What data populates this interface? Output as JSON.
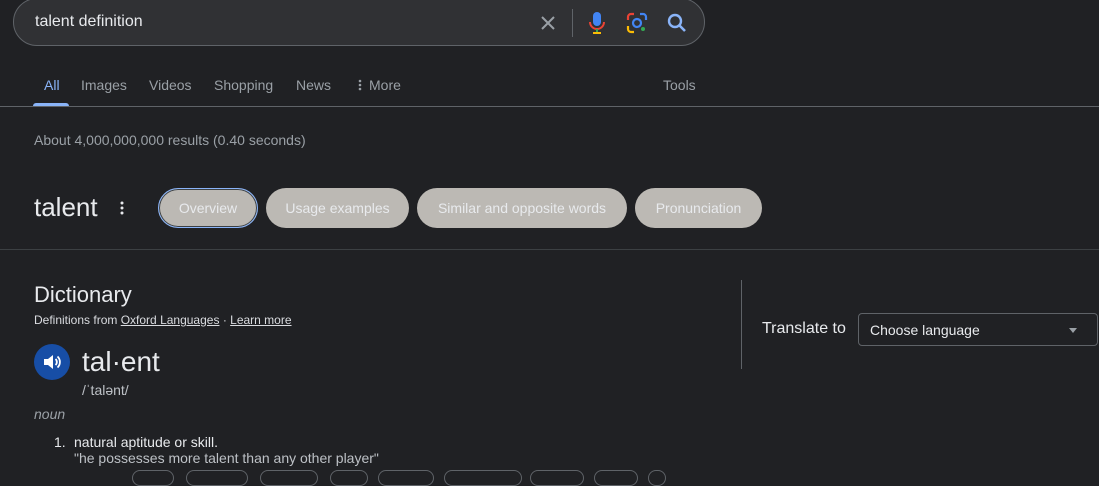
{
  "search": {
    "query": "talent definition"
  },
  "tabs": [
    {
      "label": "All"
    },
    {
      "label": "Images"
    },
    {
      "label": "Videos"
    },
    {
      "label": "Shopping"
    },
    {
      "label": "News"
    },
    {
      "label": "More"
    }
  ],
  "tools_label": "Tools",
  "result_stats": "About 4,000,000,000 results (0.40 seconds)",
  "word": "talent",
  "chips": [
    "Overview",
    "Usage examples",
    "Similar and opposite words",
    "Pronunciation"
  ],
  "dictionary": {
    "heading": "Dictionary",
    "defs_from_prefix": "Definitions from",
    "source_link": "Oxford Languages",
    "separator": "·",
    "learn_more": "Learn more",
    "headword": "tal·ent",
    "phonetic": "/ˈtalənt/",
    "part_of_speech": "noun",
    "definitions": [
      {
        "number": "1.",
        "text": "natural aptitude or skill.",
        "example": "\"he possesses more talent than any other player\""
      }
    ]
  },
  "translate": {
    "label": "Translate to",
    "placeholder": "Choose language"
  },
  "colors": {
    "background": "#202124",
    "accent": "#8ab4f8",
    "chip": "#bcb9b4",
    "speaker": "#174ea6"
  }
}
